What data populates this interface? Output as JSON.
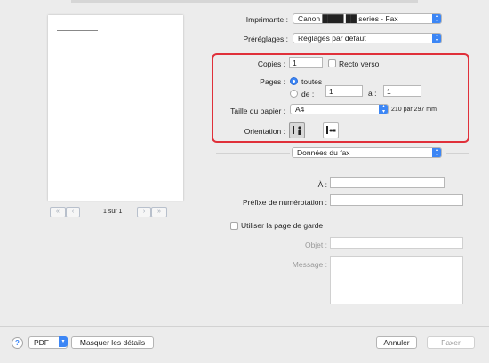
{
  "preview": {
    "pager": {
      "first": "«",
      "prev": "‹",
      "next": "›",
      "last": "»",
      "label": "1 sur 1"
    }
  },
  "printer": {
    "label": "Imprimante :",
    "value": "Canon ████ ██ series - Fax"
  },
  "presets": {
    "label": "Préréglages :",
    "value": "Réglages par défaut"
  },
  "copies": {
    "label": "Copies :",
    "value": "1",
    "duplex_label": "Recto verso"
  },
  "pages": {
    "label": "Pages :",
    "all_label": "toutes",
    "from_label": "de :",
    "from_value": "1",
    "to_label": "à :",
    "to_value": "1"
  },
  "paper": {
    "label": "Taille du papier :",
    "value": "A4",
    "dimensions": "210 par 297 mm"
  },
  "orientation": {
    "label": "Orientation :"
  },
  "section": {
    "value": "Données du fax"
  },
  "fax": {
    "to_label": "À :",
    "prefix_label": "Préfixe de numérotation :",
    "cover_label": "Utiliser la page de garde",
    "subject_label": "Objet :",
    "message_label": "Message :"
  },
  "footer": {
    "help": "?",
    "pdf": "PDF",
    "details": "Masquer les détails",
    "cancel": "Annuler",
    "fax": "Faxer"
  },
  "colors": {
    "accent": "#3c86f5",
    "highlight": "#e0303a"
  }
}
